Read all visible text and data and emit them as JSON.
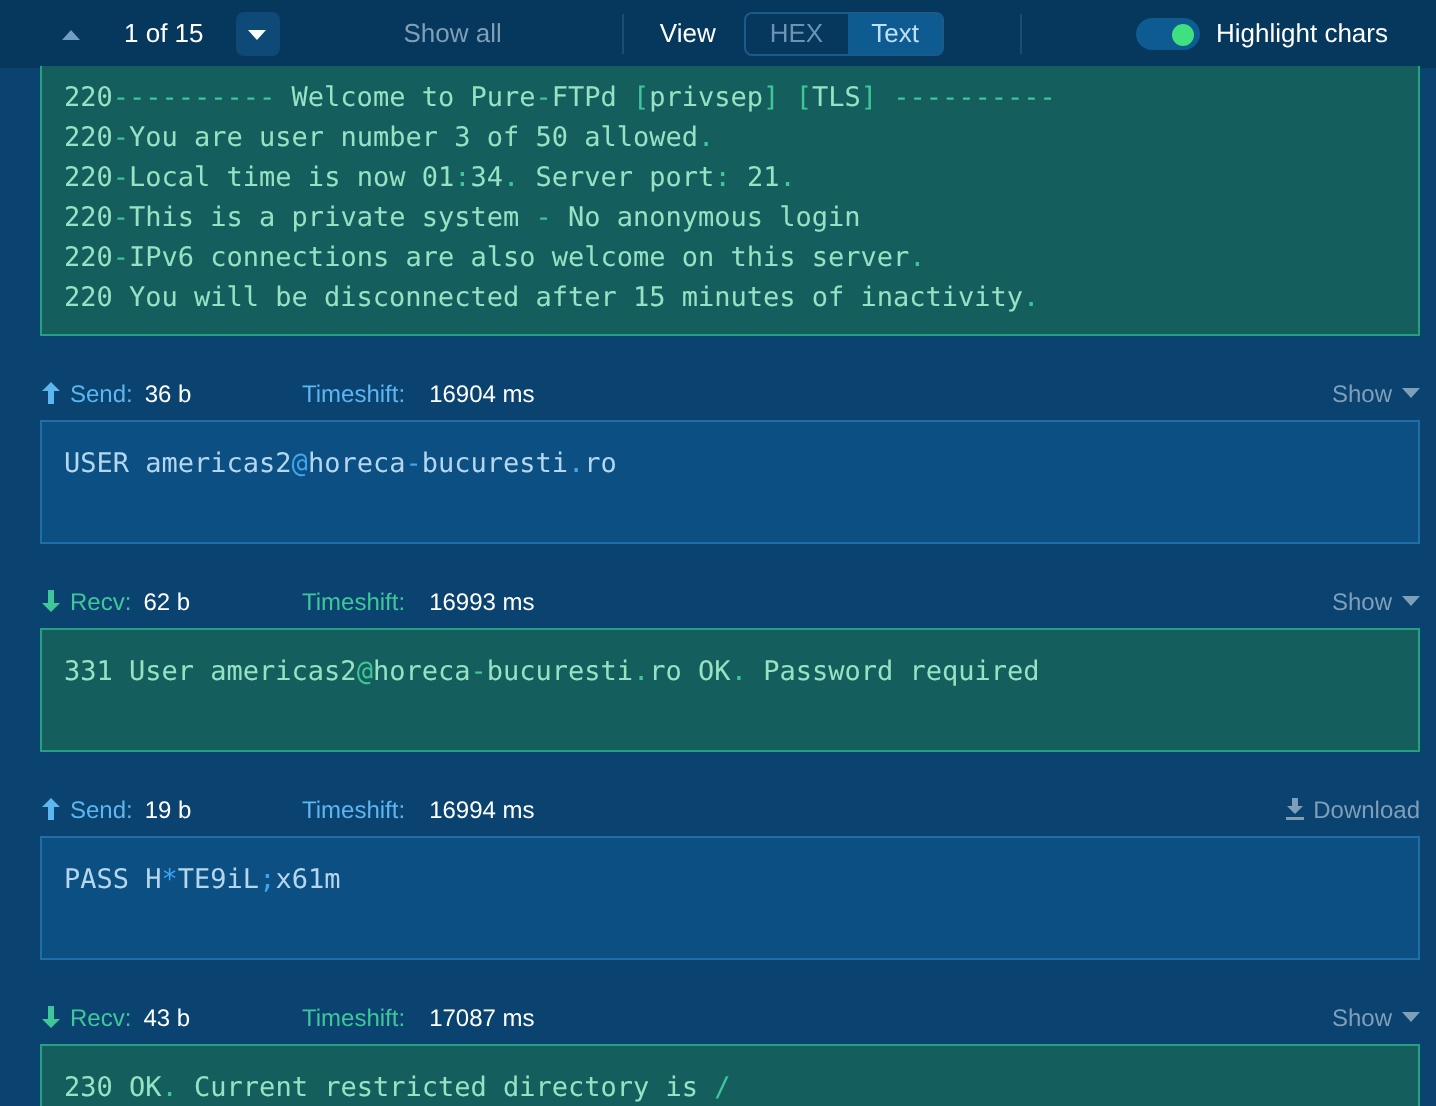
{
  "toolbar": {
    "page": "1 of 15",
    "show_all": "Show all",
    "view_label": "View",
    "view_tabs": [
      {
        "label": "HEX",
        "selected": false
      },
      {
        "label": "Text",
        "selected": true
      }
    ],
    "highlight": {
      "label": "Highlight chars",
      "on": true
    }
  },
  "packets": [
    {
      "kind": "recv",
      "lines": [
        "220---------- Welcome to Pure-FTPd [privsep] [TLS] ----------",
        "220-You are user number 3 of 50 allowed.",
        "220-Local time is now 01:34. Server port: 21.",
        "220-This is a private system - No anonymous login",
        "220-IPv6 connections are also welcome on this server.",
        "220 You will be disconnected after 15 minutes of inactivity."
      ]
    },
    {
      "kind": "send",
      "direction": "Send:",
      "size": "36 b",
      "timeshift_label": "Timeshift:",
      "timeshift": "16904 ms",
      "action": {
        "kind": "show",
        "label": "Show"
      },
      "lines": [
        "USER americas2@horeca-bucuresti.ro"
      ]
    },
    {
      "kind": "recv",
      "direction": "Recv:",
      "size": "62 b",
      "timeshift_label": "Timeshift:",
      "timeshift": "16993 ms",
      "action": {
        "kind": "show",
        "label": "Show"
      },
      "lines": [
        "331 User americas2@horeca-bucuresti.ro OK. Password required"
      ]
    },
    {
      "kind": "send",
      "direction": "Send:",
      "size": "19 b",
      "timeshift_label": "Timeshift:",
      "timeshift": "16994 ms",
      "action": {
        "kind": "download",
        "label": "Download"
      },
      "lines": [
        "PASS H*TE9iL;x61m"
      ]
    },
    {
      "kind": "recv",
      "direction": "Recv:",
      "size": "43 b",
      "timeshift_label": "Timeshift:",
      "timeshift": "17087 ms",
      "action": {
        "kind": "show",
        "label": "Show"
      },
      "lines": [
        "230 OK. Current restricted directory is /"
      ]
    }
  ]
}
